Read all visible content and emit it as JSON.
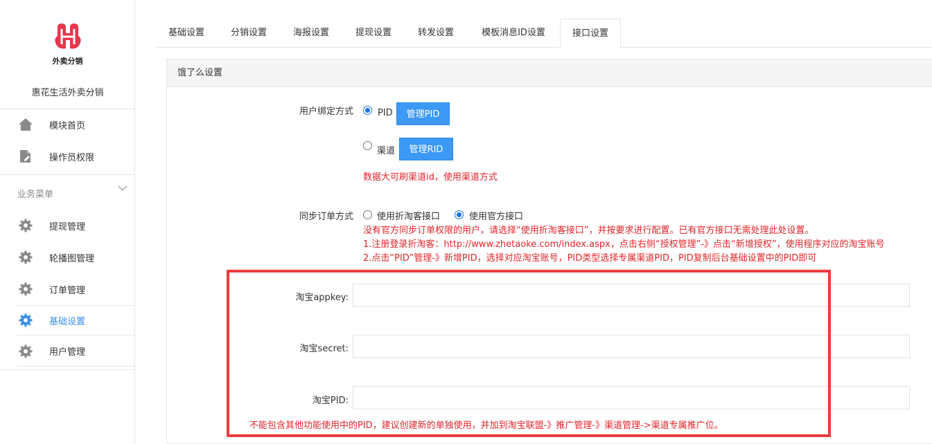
{
  "sidebar": {
    "logo_text": "外卖分销",
    "shop_name": "惠花生活外卖分销",
    "top_items": [
      {
        "label": "模块首页",
        "icon": "home-icon"
      },
      {
        "label": "操作员权限",
        "icon": "document-edit-icon"
      }
    ],
    "group_title": "业务菜单",
    "group_items": [
      {
        "label": "提现管理",
        "icon": "gear-icon"
      },
      {
        "label": "轮播图管理",
        "icon": "gear-icon"
      },
      {
        "label": "订单管理",
        "icon": "gear-icon"
      },
      {
        "label": "基础设置",
        "icon": "gear-icon",
        "active": true
      },
      {
        "label": "用户管理",
        "icon": "gear-icon"
      }
    ]
  },
  "tabs": [
    {
      "label": "基础设置"
    },
    {
      "label": "分销设置"
    },
    {
      "label": "海报设置"
    },
    {
      "label": "提现设置"
    },
    {
      "label": "转发设置"
    },
    {
      "label": "模板消息ID设置"
    },
    {
      "label": "接口设置",
      "active": true
    }
  ],
  "panel": {
    "title": "饿了么设置",
    "bind_mode": {
      "label": "用户绑定方式",
      "options": [
        {
          "label": "PID",
          "selected": true,
          "button": "管理PID"
        },
        {
          "label": "渠道",
          "selected": false,
          "button": "管理RID"
        }
      ],
      "hint": "数据大可刷渠道id，使用渠道方式"
    },
    "sync_mode": {
      "label": "同步订单方式",
      "options": [
        {
          "label": "使用折淘客接口",
          "selected": false
        },
        {
          "label": "使用官方接口",
          "selected": true
        }
      ],
      "hints": [
        "没有官方同步订单权限的用户，请选择“使用折淘客接口”，并按要求进行配置。已有官方接口无需处理此处设置。",
        "1.注册登录折淘客：http://www.zhetaoke.com/index.aspx，点击右侧“授权管理”-》点击“新增授权”，使用程序对应的淘宝账号",
        "2.点击“PID”管理-》新增PID，选择对应淘宝账号，PID类型选择专属渠道PID，PID复制后台基础设置中的PID即可"
      ]
    },
    "fields": [
      {
        "label": "淘宝appkey:",
        "value": "",
        "placeholder": ""
      },
      {
        "label": "淘宝secret:",
        "value": "",
        "placeholder": ""
      },
      {
        "label": "淘宝PID:",
        "value": "",
        "placeholder": ""
      }
    ],
    "pid_hint": "不能包含其他功能使用中的PID，建议创建新的单独使用，并加到淘宝联盟-》推广管理-》渠道管理->渠道专属推广位。"
  },
  "colors": {
    "accent": "#3c99f5",
    "hint": "#e0252a",
    "highlight_box": "#ef3a3a",
    "logo": "#e8344e"
  }
}
